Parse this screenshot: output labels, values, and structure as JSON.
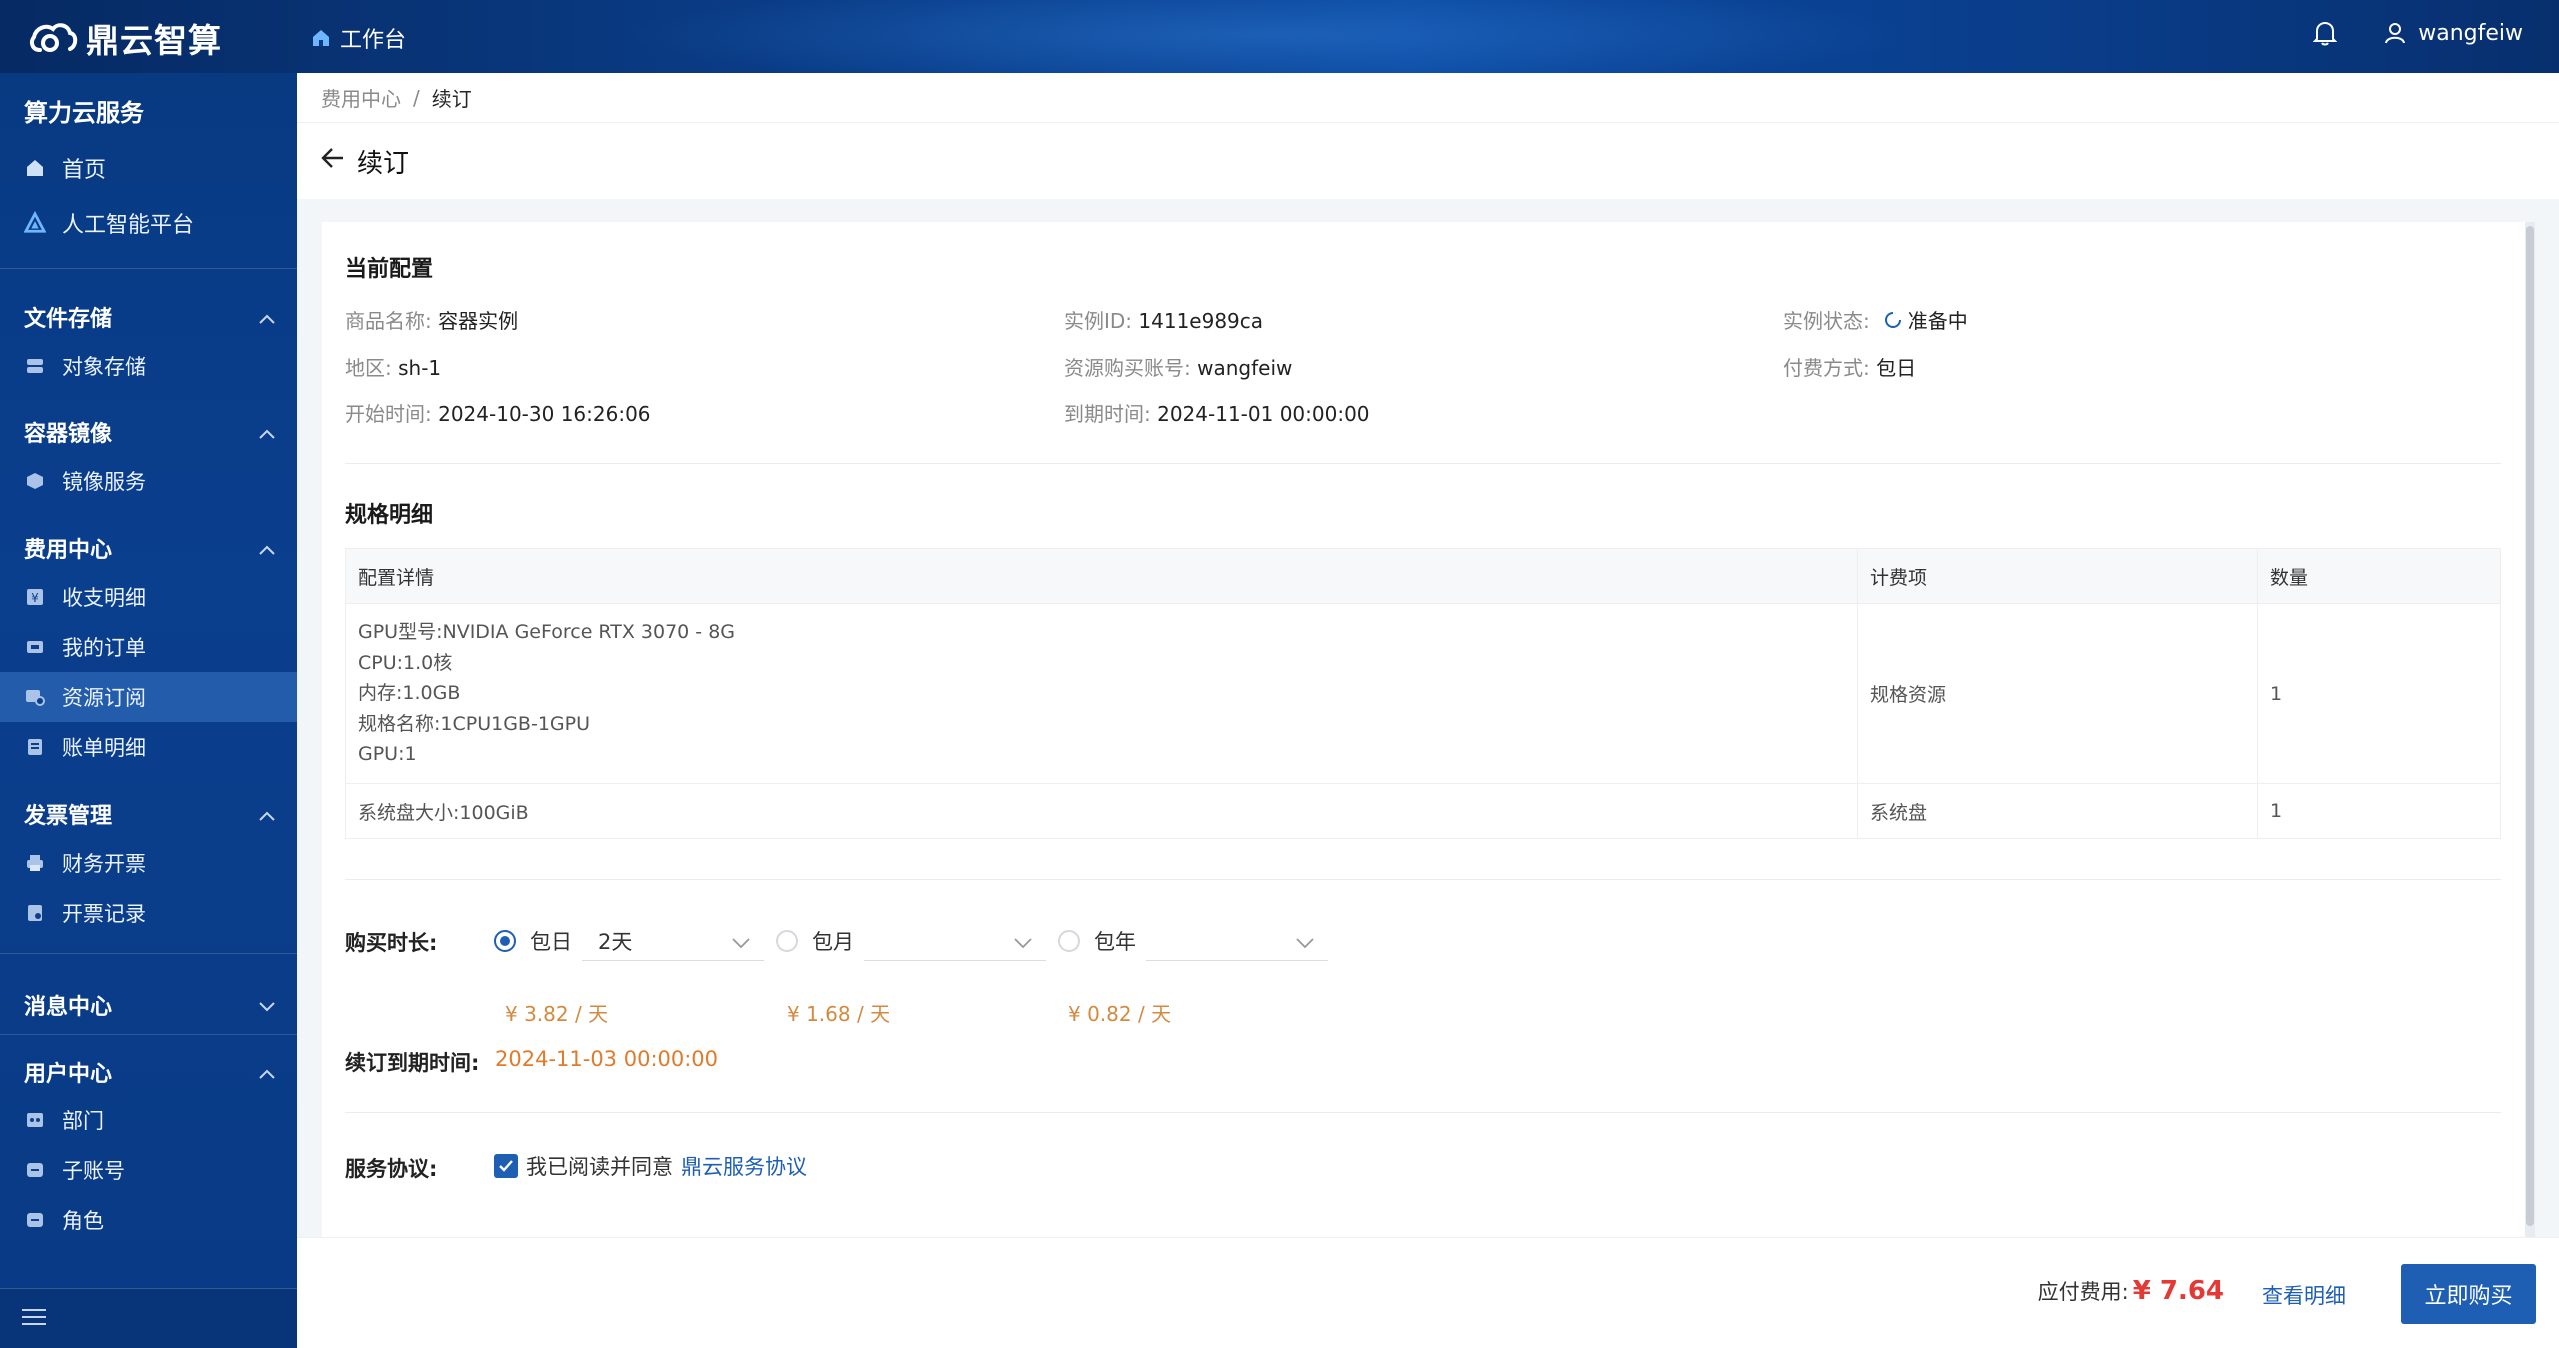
{
  "header": {
    "brand": "鼎云智算",
    "workbench": "工作台",
    "username": "wangfeiw"
  },
  "sidebar": {
    "title": "算力云服务",
    "top_items": [
      {
        "label": "首页",
        "icon": "home-icon"
      },
      {
        "label": "人工智能平台",
        "icon": "ai-platform-icon"
      }
    ],
    "groups": [
      {
        "label": "文件存储",
        "items": [
          {
            "label": "对象存储",
            "icon": "storage-icon"
          }
        ]
      },
      {
        "label": "容器镜像",
        "items": [
          {
            "label": "镜像服务",
            "icon": "cube-icon"
          }
        ]
      },
      {
        "label": "费用中心",
        "items": [
          {
            "label": "收支明细",
            "icon": "yen-icon"
          },
          {
            "label": "我的订单",
            "icon": "order-icon"
          },
          {
            "label": "资源订阅",
            "icon": "subscription-icon",
            "active": true
          },
          {
            "label": "账单明细",
            "icon": "bill-icon"
          }
        ]
      },
      {
        "label": "发票管理",
        "items": [
          {
            "label": "财务开票",
            "icon": "printer-icon"
          },
          {
            "label": "开票记录",
            "icon": "record-icon"
          }
        ]
      },
      {
        "label": "消息中心",
        "items": []
      },
      {
        "label": "用户中心",
        "items": [
          {
            "label": "部门",
            "icon": "department-icon"
          },
          {
            "label": "子账号",
            "icon": "subaccount-icon"
          },
          {
            "label": "角色",
            "icon": "role-icon"
          }
        ]
      }
    ]
  },
  "breadcrumb": {
    "parent": "费用中心",
    "separator": "/",
    "current": "续订"
  },
  "page": {
    "title": "续订"
  },
  "current_config": {
    "title": "当前配置",
    "product_label": "商品名称:",
    "product_value": "容器实例",
    "instance_id_label": "实例ID:",
    "instance_id_value": "1411e989ca",
    "status_label": "实例状态:",
    "status_value": "准备中",
    "region_label": "地区:",
    "region_value": "sh-1",
    "account_label": "资源购买账号:",
    "account_value": "wangfeiw",
    "billing_label": "付费方式:",
    "billing_value": "包日",
    "start_label": "开始时间:",
    "start_value": "2024-10-30 16:26:06",
    "end_label": "到期时间:",
    "end_value": "2024-11-01 00:00:00"
  },
  "spec": {
    "title": "规格明细",
    "columns": [
      "配置详情",
      "计费项",
      "数量"
    ],
    "rows": [
      {
        "details": [
          "GPU型号:NVIDIA GeForce RTX 3070 - 8G",
          "CPU:1.0核",
          "内存:1.0GB",
          "规格名称:1CPU1GB-1GPU",
          "GPU:1"
        ],
        "item": "规格资源",
        "qty": "1"
      },
      {
        "details": [
          "系统盘大小:100GiB"
        ],
        "item": "系统盘",
        "qty": "1"
      }
    ]
  },
  "purchase": {
    "duration_label": "购买时长:",
    "options": [
      {
        "label": "包日",
        "value": "2天",
        "price": "¥ 3.82 / 天",
        "selected": true
      },
      {
        "label": "包月",
        "value": "",
        "price": "¥ 1.68 / 天",
        "selected": false
      },
      {
        "label": "包年",
        "value": "",
        "price": "¥ 0.82 / 天",
        "selected": false
      }
    ],
    "renew_end_label": "续订到期时间:",
    "renew_end_value": "2024-11-03 00:00:00"
  },
  "agreement": {
    "label": "服务协议:",
    "text": "我已阅读并同意",
    "link": "鼎云服务协议",
    "checked": true
  },
  "footer": {
    "fee_label": "应付费用:",
    "fee_value": "¥ 7.64",
    "detail_link": "查看明细",
    "buy_button": "立即购买"
  },
  "colors": {
    "primary": "#1e5fb4",
    "price": "#e53935",
    "accent_orange": "#e07b2c",
    "sidebar_bg": "#0a3f8e"
  }
}
